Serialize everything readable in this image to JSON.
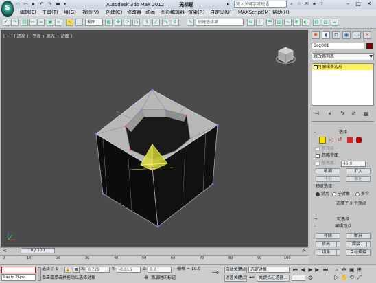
{
  "title_bar": {
    "app_name": "Autodesk 3ds Max  2012",
    "document": "无标题",
    "search_placeholder": "键入关键字或短语",
    "quick_access": [
      "new",
      "open",
      "save",
      "undo",
      "redo"
    ]
  },
  "menu": [
    "编辑(E)",
    "工具(T)",
    "组(G)",
    "视图(V)",
    "创建(C)",
    "修改器",
    "动画",
    "图形编辑器",
    "渲染(R)",
    "自定义(U)",
    "MAXScript(M)",
    "帮助(H)"
  ],
  "toolbar": {
    "selection_filter": "视图",
    "named_selection": "创建选择集"
  },
  "viewport": {
    "label": "[ + ] [ 透视 ] [ 平滑 + 高光 + 边面 ]",
    "background": "#4b4b4b"
  },
  "command_panel": {
    "object_name": "Box001",
    "object_color": "#7a0000",
    "modifier_list": "修改器列表",
    "stack_item": "可编辑多边形",
    "selection_rollout": {
      "title": "选择",
      "by_vertex": "按顶点",
      "ignore_backfacing": "忽略背面",
      "by_angle": "按角度：",
      "angle_value": "45.0",
      "shrink": "收缩",
      "grow": "扩大",
      "ring": "环形",
      "loop": "循环",
      "preview_selection": "预览选择",
      "preview_options": [
        "禁用",
        "子对象",
        "多个"
      ],
      "status": "选择了 0 个顶点"
    },
    "soft_selection_title": "软选择",
    "edit_vertices": {
      "title": "编辑顶点",
      "remove": "移除",
      "break": "断开",
      "extrude": "挤出",
      "weld": "焊接",
      "chamfer": "切角",
      "target_weld": "目标焊接"
    }
  },
  "timeline": {
    "frame": "0 / 100",
    "ticks": [
      "0",
      "10",
      "20",
      "30",
      "40",
      "50",
      "60",
      "70",
      "80",
      "90",
      "100"
    ]
  },
  "status": {
    "maxscript": "Max to Physc",
    "selected": "选择了 1",
    "prompt": "单击或单击并拖动以选择对象",
    "x_label": "X:",
    "x_value": "0.729",
    "y_label": "Y:",
    "y_value": "-0.615",
    "z_label": "Z:",
    "z_value": "0.0",
    "grid": "栅格 = 10.0",
    "add_time_tag": "添加时间标记",
    "auto_key": "自动关键点",
    "set_key": "设置关键点",
    "selected_object": "选定对象",
    "key_filters": "关键点过滤器..."
  }
}
